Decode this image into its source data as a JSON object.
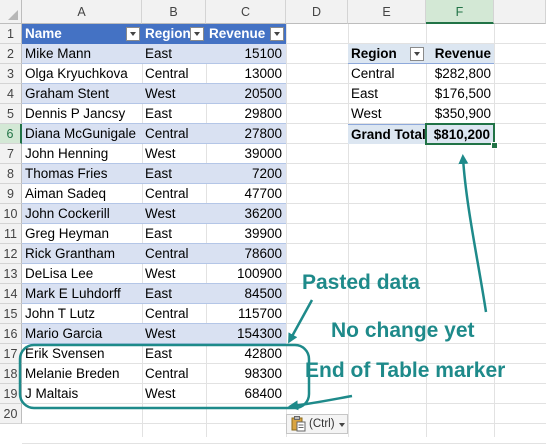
{
  "columns": [
    "A",
    "B",
    "C",
    "D",
    "E",
    "F"
  ],
  "rows": [
    "1",
    "2",
    "3",
    "4",
    "5",
    "6",
    "7",
    "8",
    "9",
    "10",
    "11",
    "12",
    "13",
    "14",
    "15",
    "16",
    "17",
    "18",
    "19",
    "20"
  ],
  "table": {
    "headers": [
      "Name",
      "Region",
      "Revenue"
    ],
    "rows": [
      [
        "Mike Mann",
        "East",
        "15100"
      ],
      [
        "Olga Kryuchkova",
        "Central",
        "13000"
      ],
      [
        "Graham Stent",
        "West",
        "20500"
      ],
      [
        "Dennis P Jancsy",
        "East",
        "29800"
      ],
      [
        "Diana McGunigale",
        "Central",
        "27800"
      ],
      [
        "John Henning",
        "West",
        "39000"
      ],
      [
        "Thomas Fries",
        "East",
        "7200"
      ],
      [
        "Aiman Sadeq",
        "Central",
        "47700"
      ],
      [
        "John Cockerill",
        "West",
        "36200"
      ],
      [
        "Greg Heyman",
        "East",
        "39900"
      ],
      [
        "Rick Grantham",
        "Central",
        "78600"
      ],
      [
        "DeLisa Lee",
        "West",
        "100900"
      ],
      [
        "Mark E Luhdorff",
        "East",
        "84500"
      ],
      [
        "John T Lutz",
        "Central",
        "115700"
      ],
      [
        "Mario Garcia",
        "West",
        "154300"
      ],
      [
        "Erik Svensen",
        "East",
        "42800"
      ],
      [
        "Melanie Breden",
        "Central",
        "98300"
      ],
      [
        "J Maltais",
        "West",
        "68400"
      ]
    ]
  },
  "pivot": {
    "headers": [
      "Region",
      "Revenue"
    ],
    "rows": [
      [
        "Central",
        "$282,800"
      ],
      [
        "East",
        "$176,500"
      ],
      [
        "West",
        "$350,900"
      ]
    ],
    "total_label": "Grand Total",
    "total_value": "$810,200"
  },
  "annotations": {
    "pasted": "Pasted data",
    "nochange": "No change yet",
    "endmarker": "End of Table marker"
  },
  "paste_options": {
    "label": "(Ctrl)",
    "icon": "clipboard-icon"
  },
  "colors": {
    "accent": "#1e8a8a",
    "table_header": "#4472c4",
    "band": "#d9e1f2",
    "selection": "#217346"
  }
}
